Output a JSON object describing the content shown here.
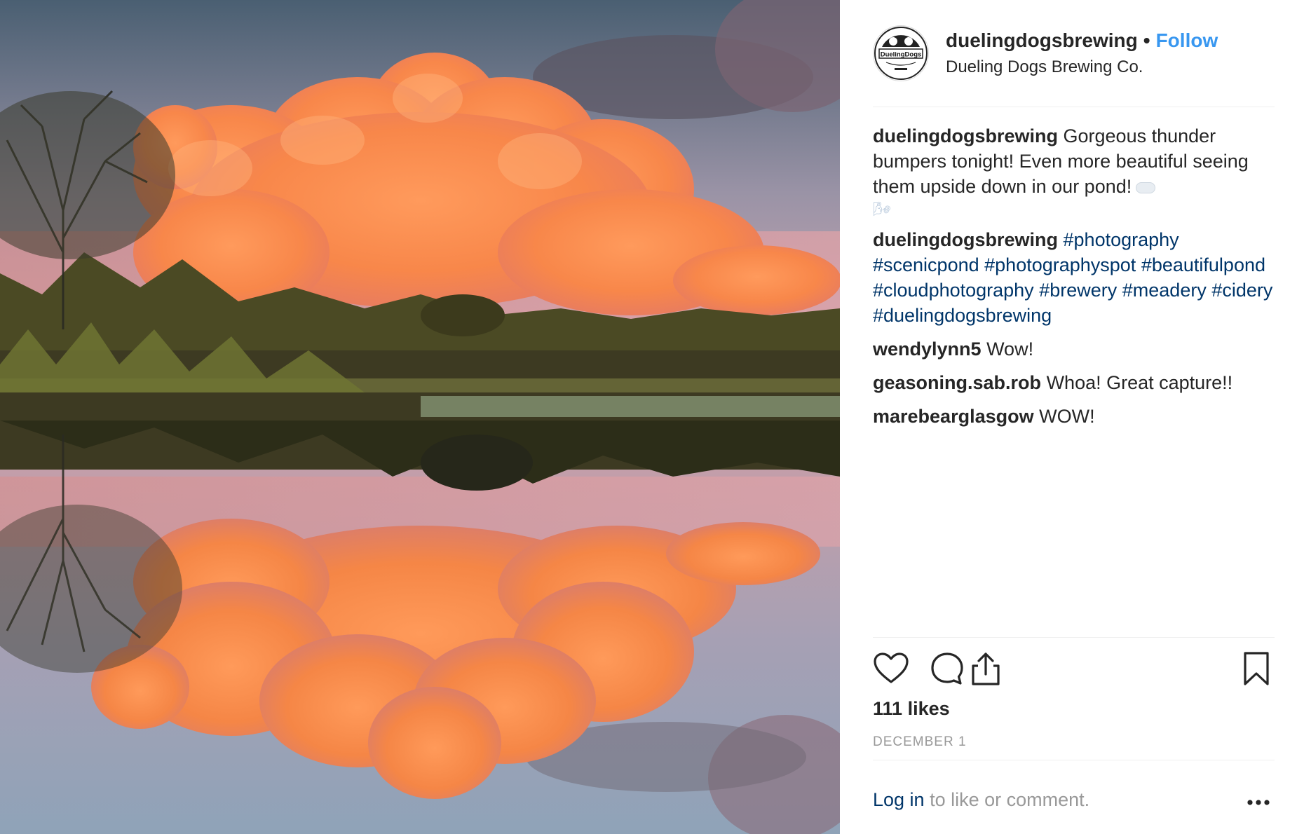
{
  "post": {
    "username": "duelingdogsbrewing",
    "separator": "•",
    "follow_label": "Follow",
    "display_name": "Dueling Dogs Brewing Co.",
    "avatar_logo_text": "DuelingDogs"
  },
  "comments": [
    {
      "author": "duelingdogsbrewing",
      "text": "Gorgeous thunder bumpers tonight! Even more beautiful seeing them upside down in our pond!",
      "emoji": "🌬"
    },
    {
      "author": "duelingdogsbrewing",
      "hashtags": [
        "#photography",
        "#scenicpond",
        "#photographyspot",
        "#beautifulpond",
        "#cloudphotography",
        "#brewery",
        "#meadery",
        "#cidery",
        "#duelingdogsbrewing"
      ]
    },
    {
      "author": "wendylynn5",
      "text": "Wow!"
    },
    {
      "author": "geasoning.sab.rob",
      "text": "Whoa! Great capture!!"
    },
    {
      "author": "marebearglasgow",
      "text": "WOW!"
    }
  ],
  "actions": {
    "like_icon": "heart-outline-icon",
    "comment_icon": "speech-bubble-icon",
    "share_icon": "share-upload-icon",
    "save_icon": "bookmark-icon"
  },
  "stats": {
    "likes": "111 likes",
    "date": "DECEMBER 1"
  },
  "footer": {
    "login_link": "Log in",
    "login_rest": " to like or comment.",
    "more_icon": "more-options-icon"
  },
  "colors": {
    "link": "#3897f0",
    "hashtag": "#003569",
    "muted": "#999999",
    "text": "#262626"
  }
}
